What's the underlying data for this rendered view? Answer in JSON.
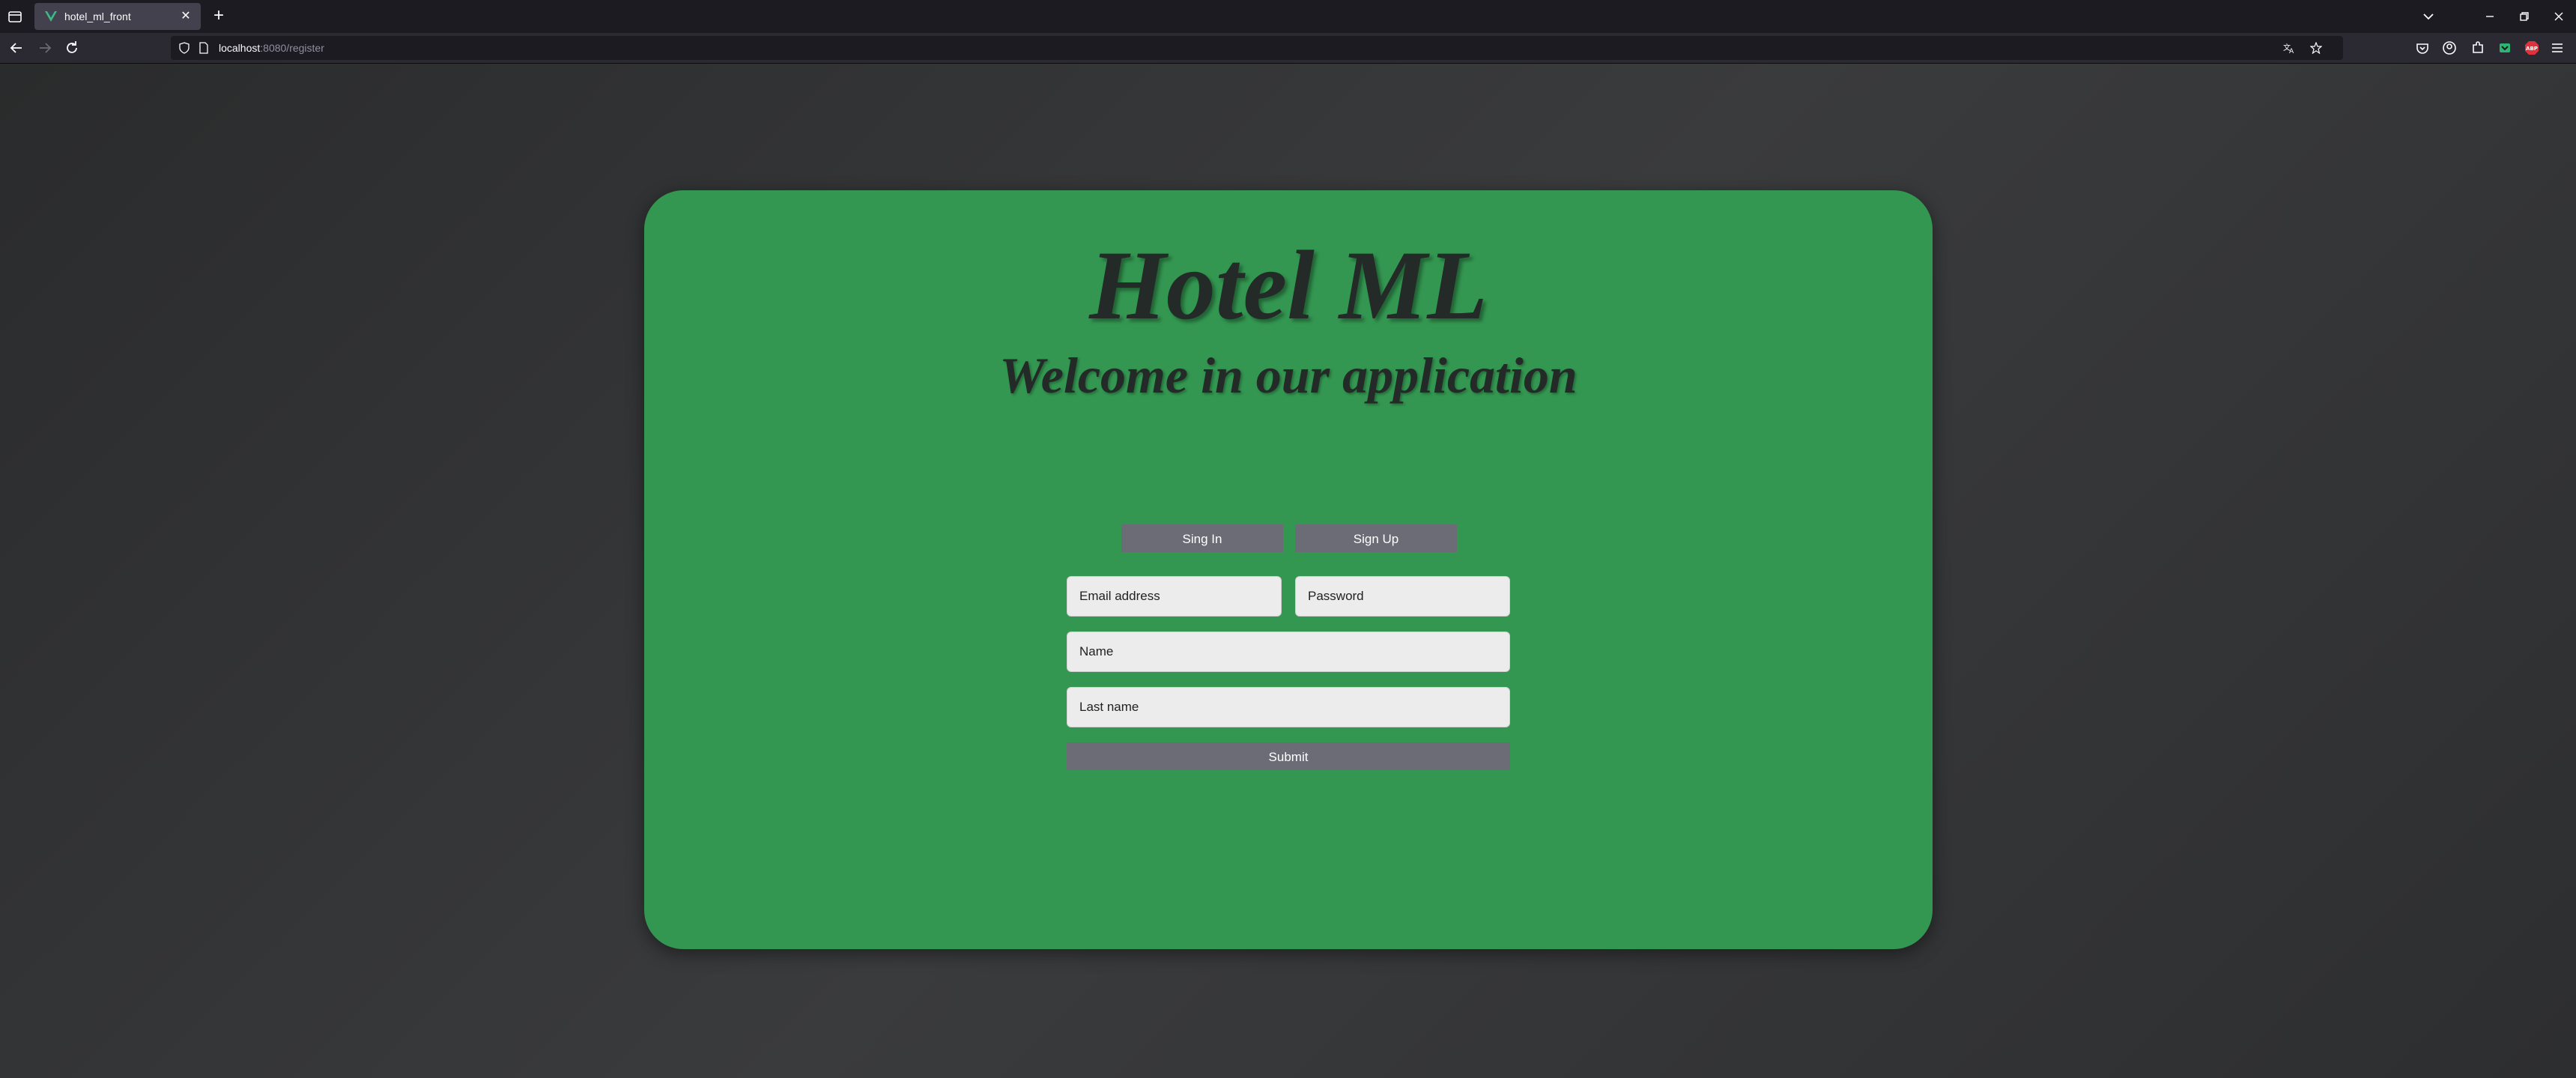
{
  "browser": {
    "tab_title": "hotel_ml_front",
    "new_tab_label": "+",
    "url_host": "localhost",
    "url_path": ":8080/register"
  },
  "page": {
    "title": "Hotel ML",
    "subtitle": "Welcome in our application",
    "signin_label": "Sing In",
    "signup_label": "Sign Up",
    "email_placeholder": "Email address",
    "password_placeholder": "Password",
    "name_placeholder": "Name",
    "lastname_placeholder": "Last name",
    "submit_label": "Submit"
  },
  "colors": {
    "card": "#339751",
    "button": "#6b6c76",
    "heading": "#242a27"
  }
}
